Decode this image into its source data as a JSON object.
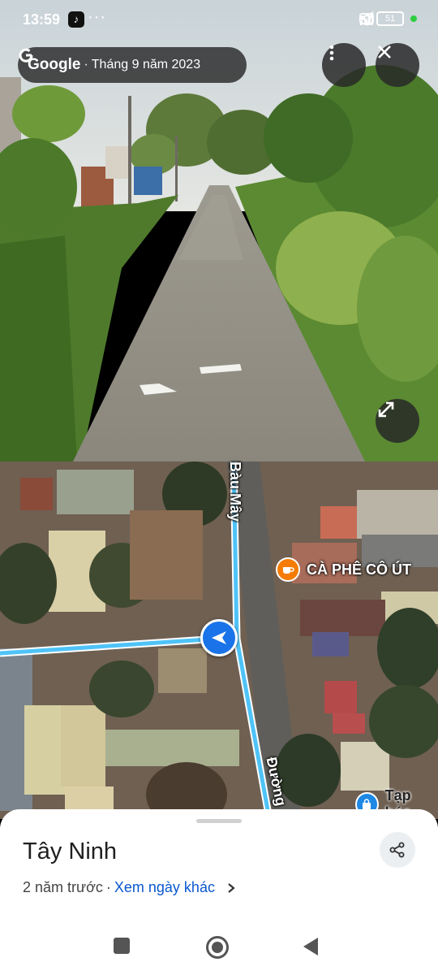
{
  "status_bar": {
    "time": "13:59",
    "network": "4G",
    "battery": "51",
    "icons": [
      "tiktok-icon",
      "more-dots-icon",
      "location-arrow-icon",
      "volte-icon",
      "signal-icon",
      "wifi-icon",
      "battery-icon"
    ]
  },
  "streetview": {
    "brand": "Google",
    "separator": "·",
    "capture_date": "Tháng 9 năm 2023",
    "menu_icon": "more-vert-icon",
    "close_icon": "close-icon",
    "expand_icon": "expand-icon"
  },
  "map": {
    "road_label_top": "Bàu Mây",
    "road_label_bottom": "Đường",
    "poi_cafe": "CÀ PHÊ CÔ ÚT",
    "poi_shop": "Tạp hóa",
    "route_color": "#4fc3f7",
    "cafe_color": "#f57c00",
    "shop_color": "#1e88e5",
    "locator_color": "#1a73e8"
  },
  "sheet": {
    "title": "Tây Ninh",
    "age": "2 năm trước",
    "separator": "·",
    "other_dates_link": "Xem ngày khác",
    "share_icon": "share-icon"
  },
  "navbar": {
    "icons": [
      "recents-square-icon",
      "home-circle-icon",
      "back-triangle-icon"
    ]
  }
}
